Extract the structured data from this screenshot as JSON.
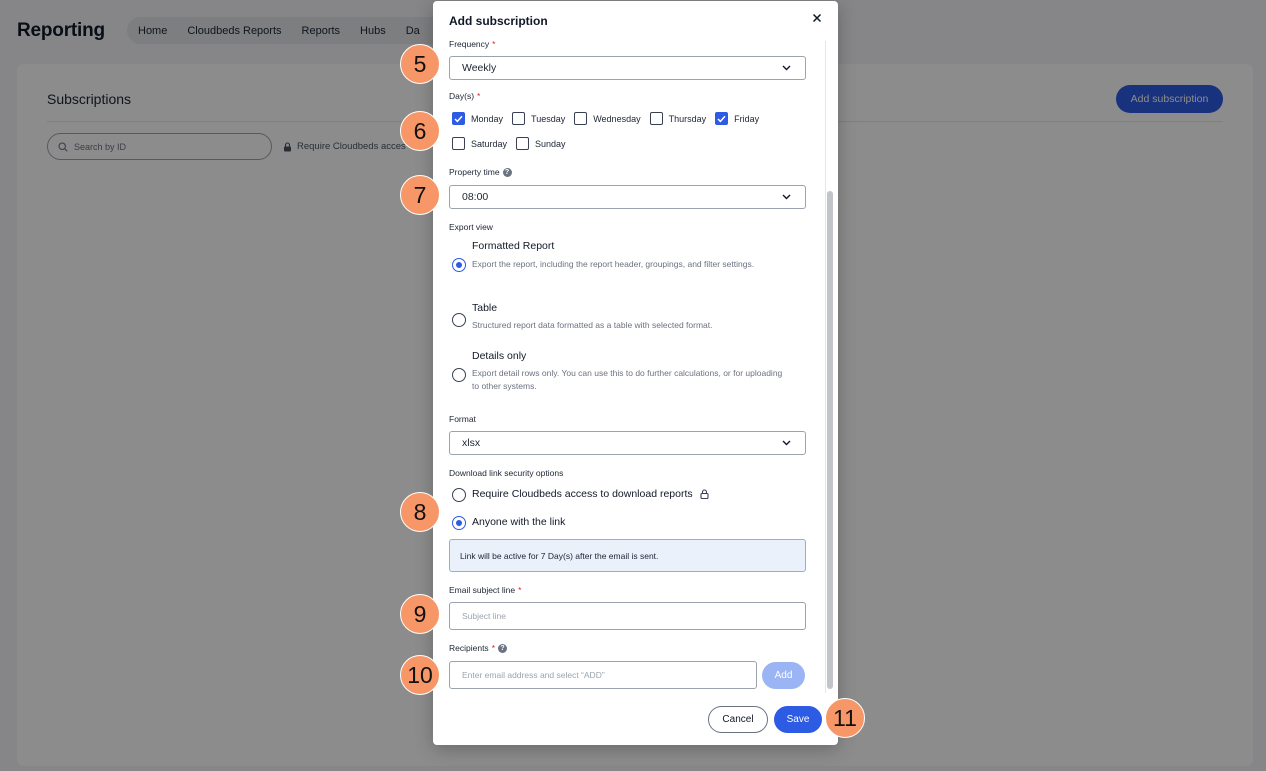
{
  "app": {
    "title": "Reporting",
    "nav": [
      "Home",
      "Cloudbeds Reports",
      "Reports",
      "Hubs",
      "Da"
    ]
  },
  "background": {
    "page_title": "Subscriptions",
    "add_subscription_label": "Add subscription",
    "search_placeholder": "Search by ID",
    "lock_filter_label": "Require Cloudbeds acces"
  },
  "modal": {
    "title": "Add subscription",
    "frequency": {
      "label": "Frequency",
      "value": "Weekly"
    },
    "days": {
      "label": "Day(s)",
      "options": [
        {
          "label": "Monday",
          "checked": true
        },
        {
          "label": "Tuesday",
          "checked": false
        },
        {
          "label": "Wednesday",
          "checked": false
        },
        {
          "label": "Thursday",
          "checked": false
        },
        {
          "label": "Friday",
          "checked": true
        },
        {
          "label": "Saturday",
          "checked": false
        },
        {
          "label": "Sunday",
          "checked": false
        }
      ]
    },
    "property_time": {
      "label": "Property time",
      "value": "08:00"
    },
    "export_view": {
      "label": "Export view",
      "options": [
        {
          "title": "Formatted Report",
          "desc": "Export the report, including the report header, groupings, and filter settings.",
          "selected": true
        },
        {
          "title": "Table",
          "desc": "Structured report data formatted as a table with selected format.",
          "selected": false
        },
        {
          "title": "Details only",
          "desc": "Export detail rows only. You can use this to do further calculations, or for uploading to other systems.",
          "selected": false
        }
      ]
    },
    "format": {
      "label": "Format",
      "value": "xlsx"
    },
    "security": {
      "label": "Download link security options",
      "options": [
        {
          "title": "Require Cloudbeds access to download reports",
          "selected": false
        },
        {
          "title": "Anyone with the link",
          "selected": true
        }
      ],
      "info": "Link will be active for 7 Day(s) after the email is sent."
    },
    "email_subject": {
      "label": "Email subject line",
      "placeholder": "Subject line"
    },
    "recipients": {
      "label": "Recipients",
      "placeholder": "Enter email address and select “ADD”",
      "add_label": "Add"
    },
    "cancel_label": "Cancel",
    "save_label": "Save"
  },
  "markers": [
    "5",
    "6",
    "7",
    "8",
    "9",
    "10",
    "11"
  ],
  "colors": {
    "accent": "#2d5be3",
    "marker": "#f79767",
    "required": "#dc2626"
  }
}
